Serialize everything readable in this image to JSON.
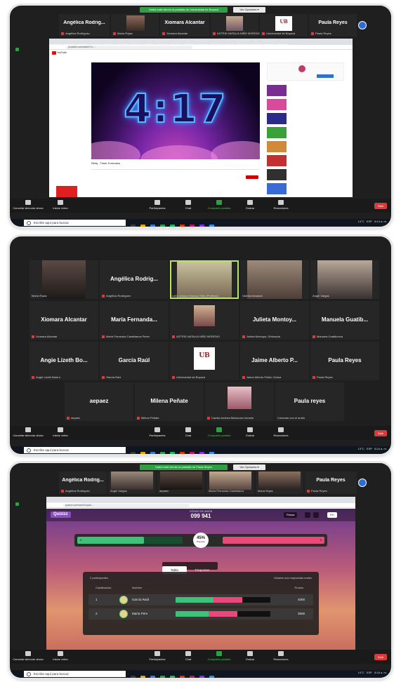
{
  "colors": {
    "zoom_dark": "#1f1f1f",
    "share_green": "#2ea043",
    "leave_red": "#d83b3b",
    "quiz_green": "#41c07a",
    "quiz_red": "#e74a7a"
  },
  "panel1": {
    "banner": "Usted está viendo la pantalla de Universidad de Boyacá",
    "view_options": "Ver Opciones ▾",
    "strip": [
      {
        "name": "Angélica Rodrig...",
        "sub": "Angélica Rodríguez"
      },
      {
        "name": "",
        "sub": "María Rojas"
      },
      {
        "name": "Xiomara Alcantar",
        "sub": "Xiomara Alcantar"
      },
      {
        "name": "",
        "sub": "ASTRID NATALIA NIÑO MORENO"
      },
      {
        "name": "",
        "sub": "Universidad de Boyacá"
      },
      {
        "name": "Paula Reyes",
        "sub": "Paula Reyes"
      }
    ],
    "browser_url": "youtube.com/watch?v=...",
    "video_time": "4:17",
    "video_title": "Reloj - Timer 5 minutos"
  },
  "panel2": {
    "grid": [
      {
        "name": "",
        "sub": "María Rojas"
      },
      {
        "name": "Angélica Rodrig...",
        "sub": "Angélica Rodríguez"
      },
      {
        "name": "",
        "sub": "Leidi Johana Guacas Ortiz (Profesor)"
      },
      {
        "name": "",
        "sub": "Valeria Alvarado"
      },
      {
        "name": "",
        "sub": "Angie Vargas"
      },
      {
        "name": "Xiomara Alcantar",
        "sub": "Xiomara Alcantar"
      },
      {
        "name": "María Fernanda...",
        "sub": "María Fernanda Castellanos Pérez"
      },
      {
        "name": "",
        "sub": "ASTRID NATALIA NIÑO MORENO"
      },
      {
        "name": "Julieta Montoy...",
        "sub": "Julieta Montoya, Orthoepia"
      },
      {
        "name": "Manuela Guatib...",
        "sub": "Manuela Guatibonza"
      },
      {
        "name": "Angie Lizeth Bo...",
        "sub": "Angie Lizeth Botero"
      },
      {
        "name": "García Raúl",
        "sub": "García Raúl"
      },
      {
        "name": "",
        "sub": "Universidad de Boyacá"
      },
      {
        "name": "Jaime Alberto P...",
        "sub": "Jaime Alberto Pulido Ochoa"
      },
      {
        "name": "Paula Reyes",
        "sub": "Paula Reyes"
      },
      {
        "name": "aepaez",
        "sub": "aepaez"
      },
      {
        "name": "Milena Peñate",
        "sub": "Milena Peñate"
      },
      {
        "name": "",
        "sub": "Camila Andrea Betancourt Acosta"
      },
      {
        "name": "Paula reyes",
        "sub": "Conectar con el audio"
      }
    ]
  },
  "panel3": {
    "banner": "Usted está viendo la pantalla de Paula Reyes",
    "view_options": "Ver Opciones ▾",
    "strip": [
      {
        "name": "Angélica Rodrig...",
        "sub": "Angélica Rodríguez"
      },
      {
        "name": "",
        "sub": "Angie Vargas"
      },
      {
        "name": "",
        "sub": "aepaez"
      },
      {
        "name": "",
        "sub": "María Fernanda Castellanos"
      },
      {
        "name": "",
        "sub": "María Rojas"
      },
      {
        "name": "Paula Reyes",
        "sub": "Paula Reyes"
      }
    ],
    "browser_url": "quizizz.com/admin/quiz/...",
    "quiz": {
      "logo": "Quizizz",
      "code_label": "CÓDIGO DE UNIÓN",
      "join_code": "099 941",
      "mute": "Pausa",
      "finish": "Fin",
      "progress_pct": "45%",
      "progress_pct_label": "Precisión",
      "progress_pct_value": 45,
      "correct_count": "6",
      "incorrect_count": "8",
      "tab_table": "Tabla",
      "tab_questions": "Preguntas",
      "participants": "2 participantes",
      "show_names": "Mostrar sus respuestas reales",
      "col_rank": "Clasificación",
      "col_name": "Nombre",
      "col_points": "Puntos",
      "rows": [
        {
          "rank": "1",
          "name": "García Raúl",
          "green": 0.4,
          "red": 0.3,
          "points": "4000"
        },
        {
          "rank": "2",
          "name": "María Pére",
          "green": 0.35,
          "red": 0.3,
          "points": "3500"
        }
      ]
    }
  },
  "toolbar": {
    "mute": "Cancelar silenciar ahora",
    "video": "Iniciar vídeo",
    "participants": "Participantes",
    "chat": "Chat",
    "share": "Compartir pantalla",
    "record": "Grabar",
    "reactions": "Reacciones",
    "leave": "Salir"
  },
  "taskbar": {
    "search": "Escribe aquí para buscar",
    "weather_p1": "14°C",
    "weather_p2": "13°C",
    "weather_p3": "14°C",
    "lang": "ESP",
    "time_p1": "8:14 a. m.",
    "time_p2": "8:24 a. m.",
    "time_p3": "8:16 a. m.",
    "date": "23/05/2022"
  }
}
